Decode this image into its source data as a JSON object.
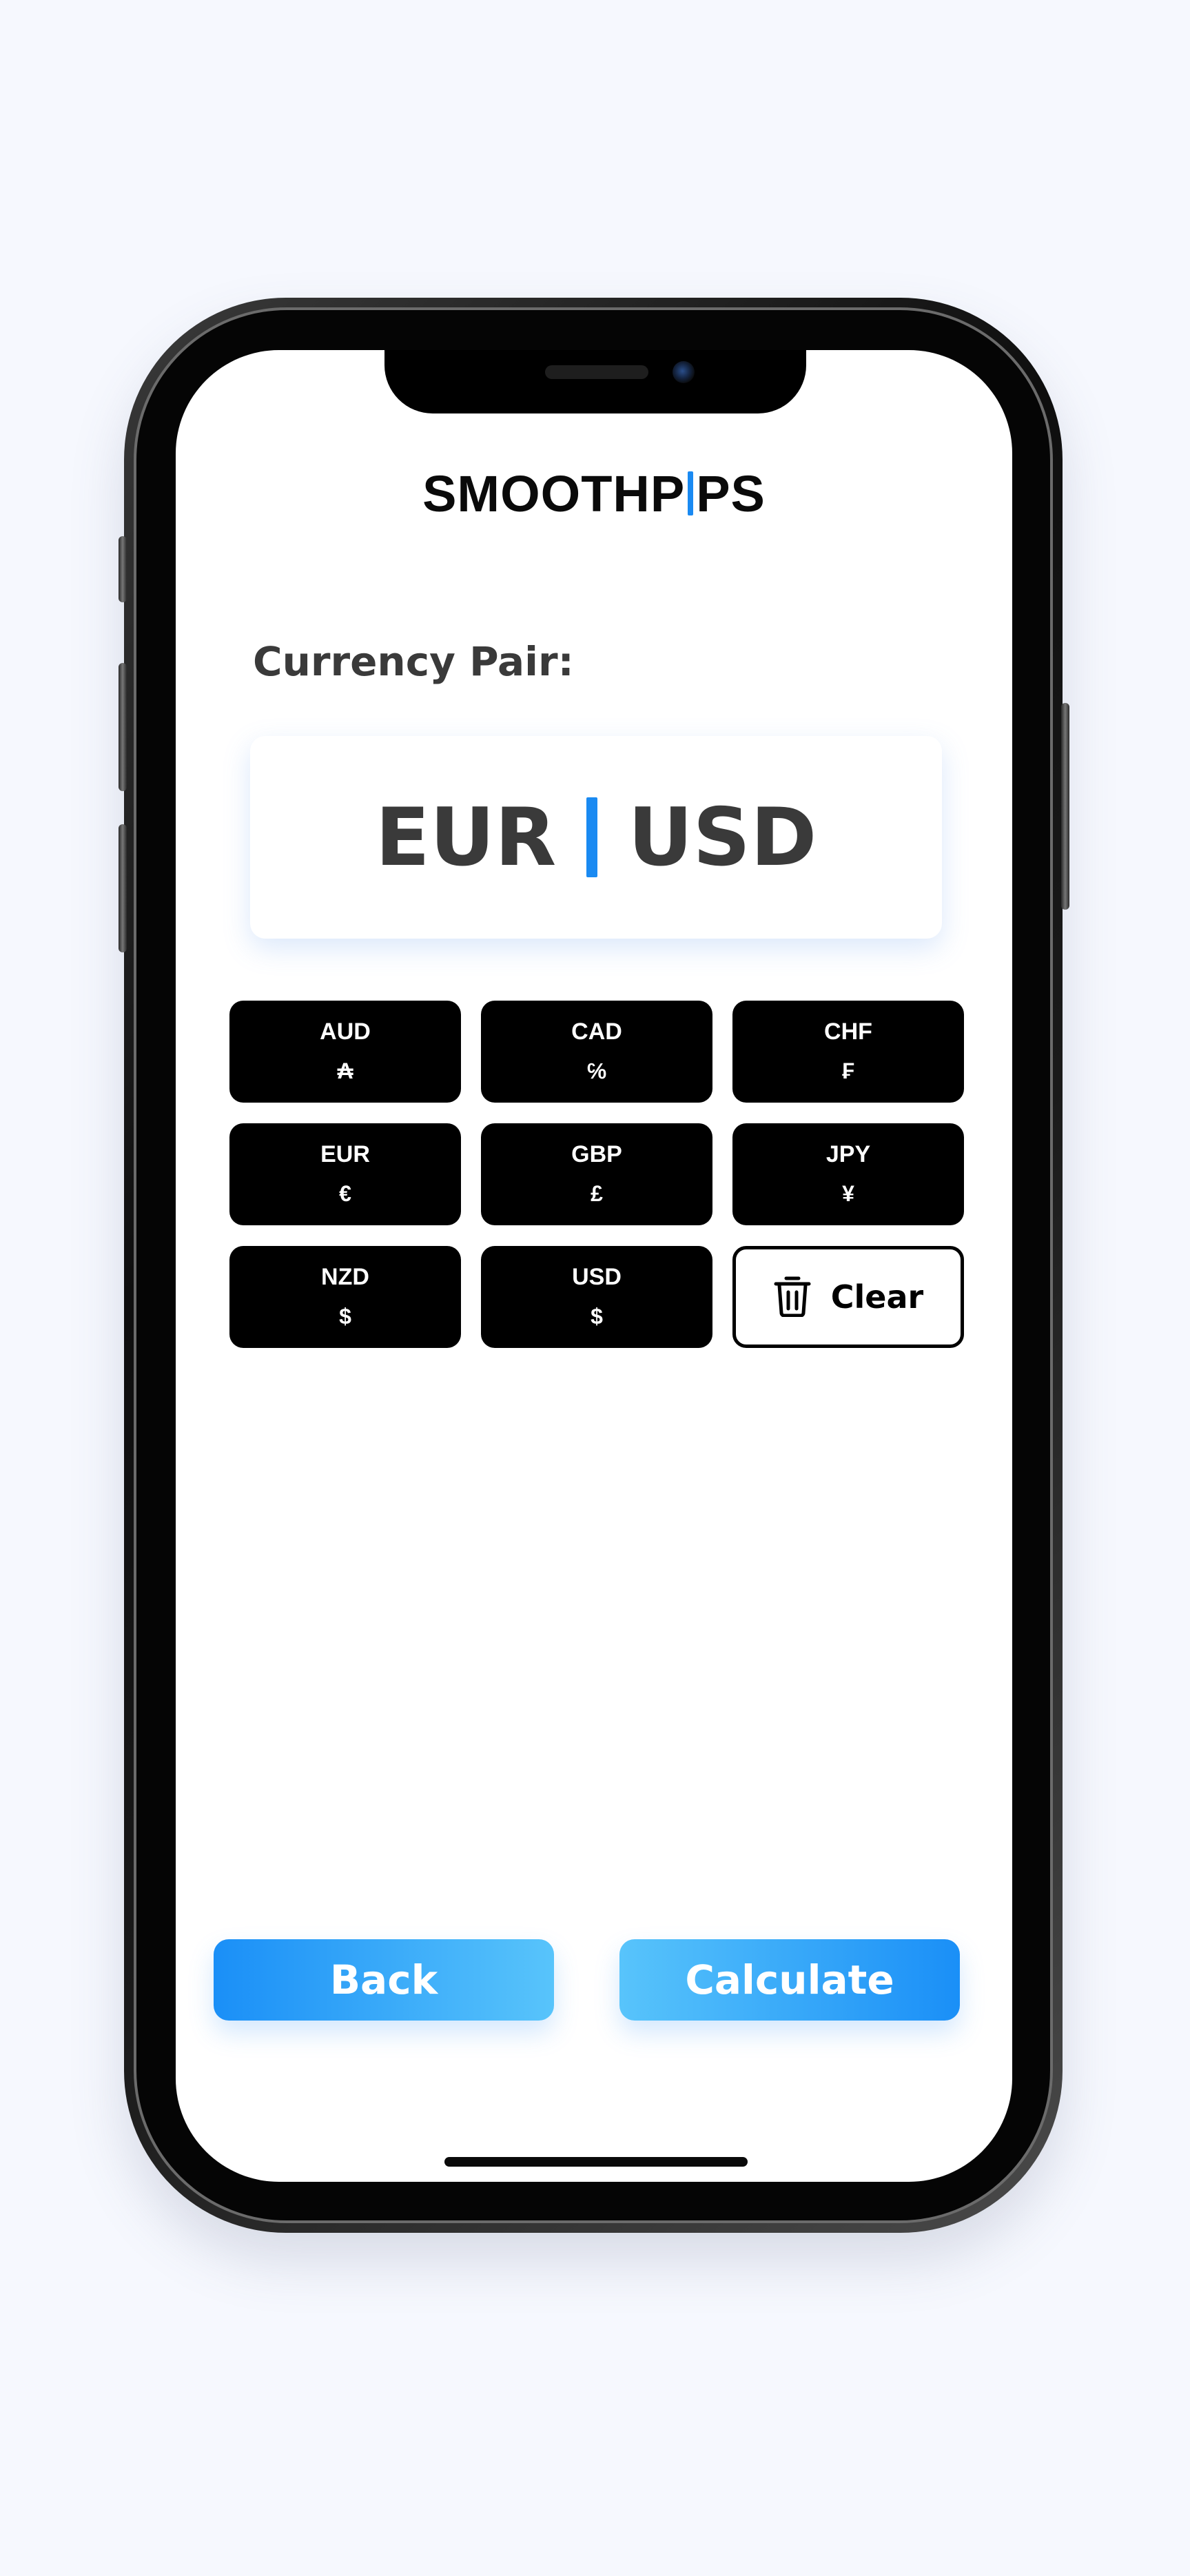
{
  "app": {
    "logo_left": "SMOOTHP",
    "logo_right": "PS"
  },
  "pair": {
    "label": "Currency Pair:",
    "base": "EUR",
    "quote": "USD"
  },
  "currencies": [
    {
      "code": "AUD",
      "symbol": "₳"
    },
    {
      "code": "CAD",
      "symbol": "℅"
    },
    {
      "code": "CHF",
      "symbol": "₣"
    },
    {
      "code": "EUR",
      "symbol": "€"
    },
    {
      "code": "GBP",
      "symbol": "£"
    },
    {
      "code": "JPY",
      "symbol": "¥"
    },
    {
      "code": "NZD",
      "symbol": "$"
    },
    {
      "code": "USD",
      "symbol": "$"
    }
  ],
  "clear": {
    "label": "Clear",
    "icon": "trash-icon"
  },
  "actions": {
    "back_label": "Back",
    "calculate_label": "Calculate"
  },
  "colors": {
    "accent": "#1a8af2",
    "accent_light": "#58c4fb",
    "button_dark": "#000000",
    "text_dark": "#3a3a3a"
  }
}
